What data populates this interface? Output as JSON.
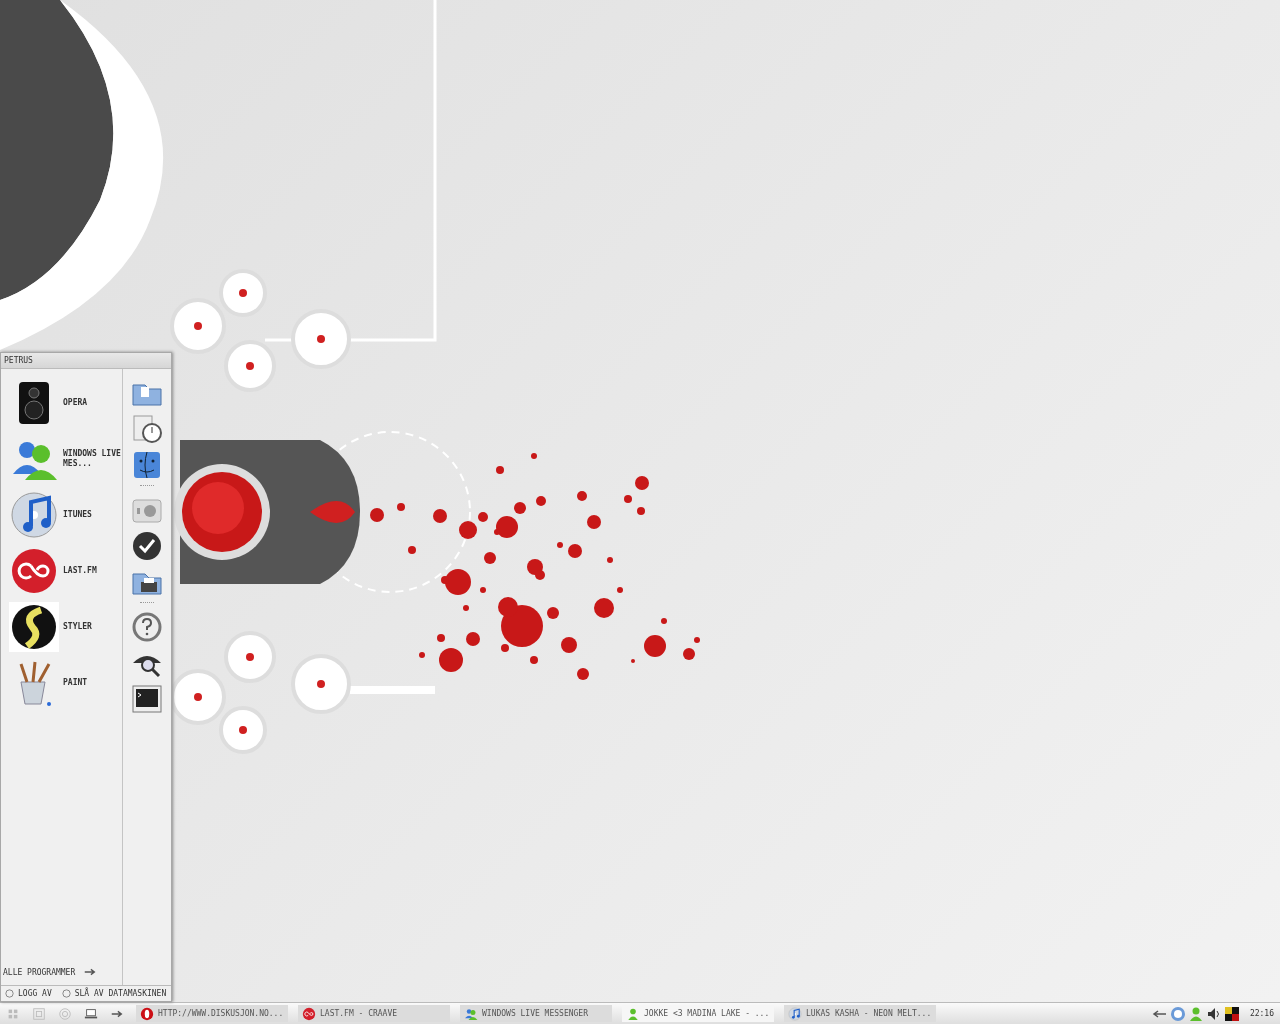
{
  "start_menu": {
    "user": "PETRUS",
    "programs": [
      {
        "label": "OPERA",
        "kind": "speaker"
      },
      {
        "label": "WINDOWS LIVE MES...",
        "kind": "people"
      },
      {
        "label": "ITUNES",
        "kind": "music"
      },
      {
        "label": "LAST.FM",
        "kind": "lastfm"
      },
      {
        "label": "STYLER",
        "kind": "styler"
      },
      {
        "label": "PAINT",
        "kind": "paint"
      }
    ],
    "places": [
      {
        "kind": "folder"
      },
      {
        "kind": "timer"
      },
      {
        "kind": "finder"
      },
      {
        "kind": "separator"
      },
      {
        "kind": "panel"
      },
      {
        "kind": "check"
      },
      {
        "kind": "printer"
      },
      {
        "kind": "separator"
      },
      {
        "kind": "help"
      },
      {
        "kind": "search"
      },
      {
        "kind": "terminal"
      }
    ],
    "all_programs": "ALLE PROGRAMMER",
    "footer": [
      {
        "label": "LOGG AV"
      },
      {
        "label": "SLÅ AV DATAMASKINEN"
      }
    ]
  },
  "taskbar": {
    "quick_launch": [
      {
        "kind": "grid"
      },
      {
        "kind": "window"
      },
      {
        "kind": "circle"
      },
      {
        "kind": "laptop"
      },
      {
        "kind": "arrow"
      }
    ],
    "tasks": [
      {
        "label": "HTTP://WWW.DISKUSJON.NO...",
        "kind": "opera",
        "selected": false
      },
      {
        "label": "LAST.FM - CRAAVE",
        "kind": "lastfm",
        "selected": false
      },
      {
        "label": "WINDOWS LIVE MESSENGER",
        "kind": "people",
        "selected": false
      },
      {
        "label": "JOKKE <3 MADINA LAKE - ...",
        "kind": "person",
        "selected": true
      },
      {
        "label": "LUKAS KASHA - NEON MELT...",
        "kind": "music",
        "selected": false
      }
    ],
    "tray": [
      {
        "kind": "arrow"
      },
      {
        "kind": "globe"
      },
      {
        "kind": "person"
      },
      {
        "kind": "speaker"
      },
      {
        "kind": "flag"
      }
    ],
    "clock": "22:16"
  }
}
